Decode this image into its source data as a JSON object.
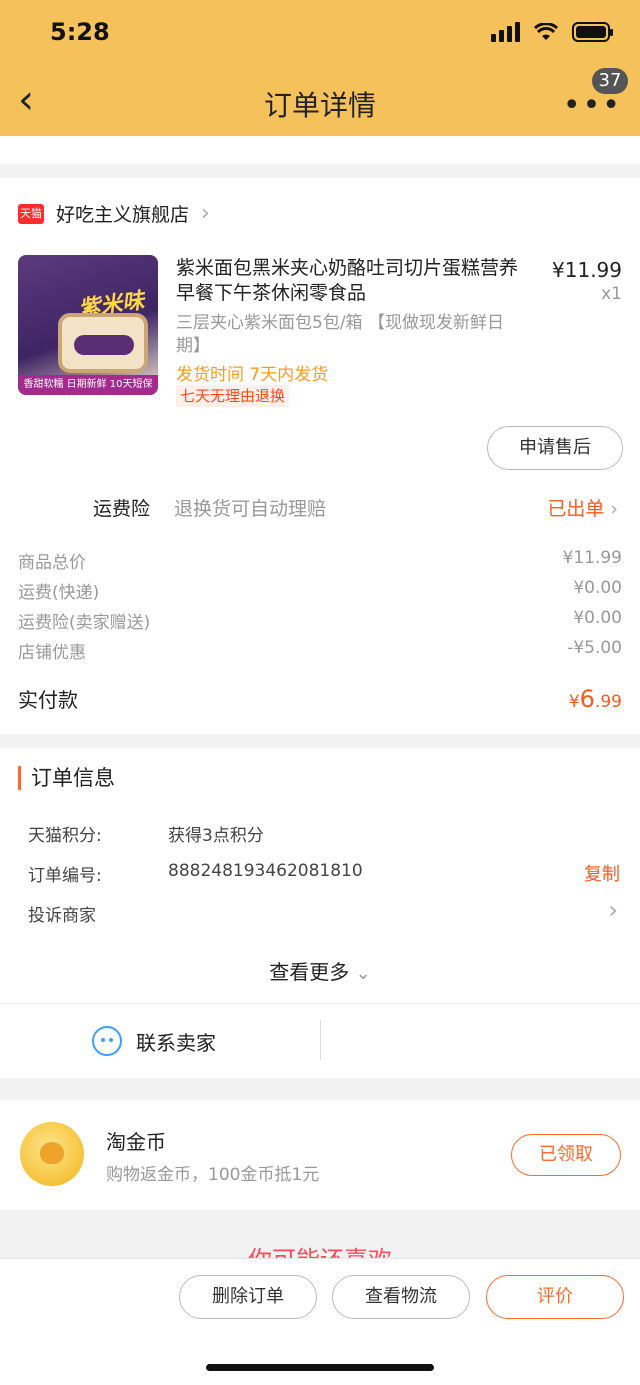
{
  "status_bar": {
    "time": "5:28"
  },
  "nav": {
    "title": "订单详情",
    "badge": "37"
  },
  "store": {
    "tag": "天猫",
    "name": "好吃主义旗舰店"
  },
  "product": {
    "image_label": "紫米味",
    "image_ribbon": "香甜软糯 日期新鲜 10天短保",
    "title": "紫米面包黑米夹心奶酪吐司切片蛋糕营养早餐下午茶休闲零食品",
    "price": "¥11.99",
    "qty": "x1",
    "sku": "三层夹心紫米面包5包/箱  【现做现发新鲜日期】",
    "ship_time": "发货时间 7天内发货",
    "return_tag": "七天无理由退换",
    "after_sale_button": "申请售后"
  },
  "insurance": {
    "label": "运费险",
    "desc": "退换货可自动理赔",
    "status": "已出单"
  },
  "fees": [
    {
      "label": "商品总价",
      "value": "¥11.99"
    },
    {
      "label": "运费(快递)",
      "value": "¥0.00"
    },
    {
      "label": "运费险(卖家赠送)",
      "value": "¥0.00"
    },
    {
      "label": "店铺优惠",
      "value": "-¥5.00"
    }
  ],
  "total": {
    "label": "实付款",
    "currency": "¥",
    "amount_main": "6",
    "amount_decimal": ".99"
  },
  "order_info": {
    "title": "订单信息",
    "points_label": "天猫积分:",
    "points_value": "获得3点积分",
    "order_no_label": "订单编号:",
    "order_no_value": "888248193462081810",
    "copy": "复制",
    "complaint": "投诉商家",
    "more": "查看更多"
  },
  "contact": {
    "label": "联系卖家"
  },
  "coins": {
    "title": "淘金币",
    "desc": "购物返金币，100金币抵1元",
    "button": "已领取"
  },
  "recommend_peek": "你可能还喜欢",
  "actions": {
    "delete": "删除订单",
    "logistics": "查看物流",
    "review": "评价"
  }
}
